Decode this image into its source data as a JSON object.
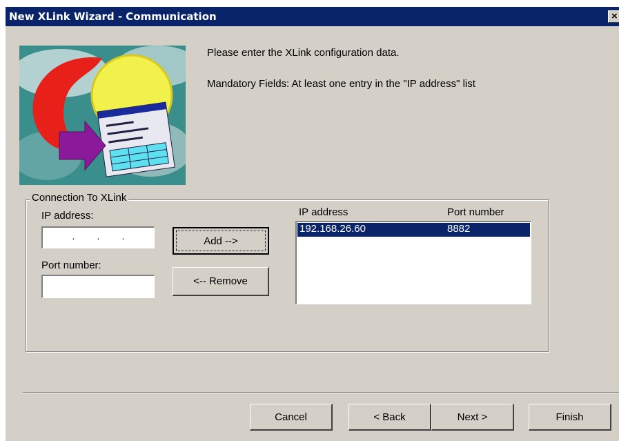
{
  "window": {
    "title": "New XLink Wizard - Communication",
    "close_glyph": "×"
  },
  "intro": {
    "line1": "Please enter the XLink configuration data.",
    "line2": "Mandatory Fields: At least one entry in the \"IP address\" list"
  },
  "group": {
    "legend": "Connection To XLink",
    "ip_label": "IP address:",
    "ip_value": "",
    "port_label": "Port number:",
    "port_value": "",
    "add_label": "Add -->",
    "remove_label": "<-- Remove"
  },
  "list": {
    "columns": [
      "IP address",
      "Port number"
    ],
    "rows": [
      {
        "ip": "192.168.26.60",
        "port": "8882",
        "selected": true
      }
    ]
  },
  "footer": {
    "cancel_label": "Cancel",
    "back_label": "< Back",
    "next_label": "Next >",
    "finish_label": "Finish"
  },
  "colors": {
    "titlebar": "#0a246a",
    "face": "#d4d0c8",
    "selection": "#0a246a"
  },
  "icons": {
    "close": "close-icon",
    "wizard": "wizard-illustration"
  }
}
